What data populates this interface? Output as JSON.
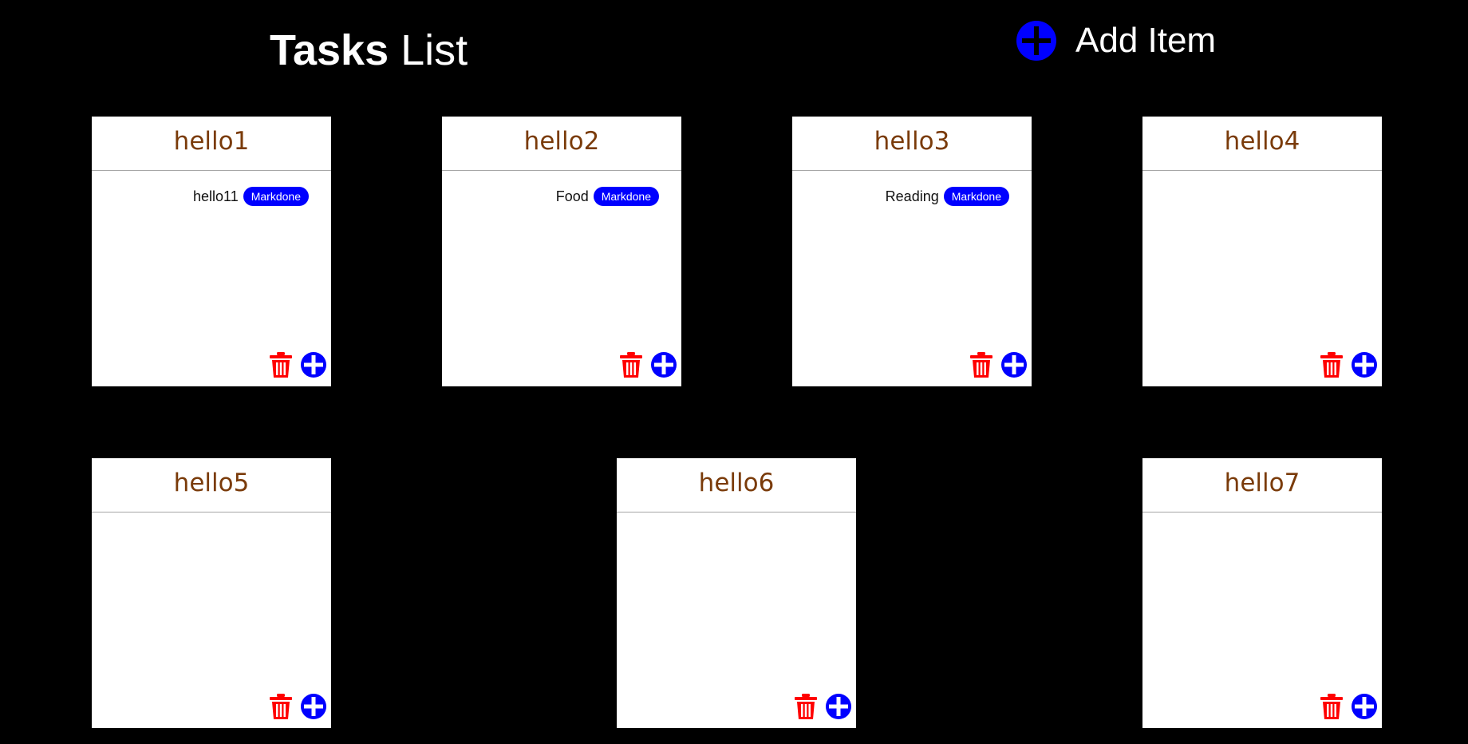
{
  "header": {
    "title_bold": "Tasks",
    "title_rest": "List",
    "add_item_label": "Add Item"
  },
  "colors": {
    "background": "#000000",
    "accent_blue": "#0000ff",
    "delete_red": "#ff0000",
    "card_title": "#7a3b0a"
  },
  "icons": {
    "add": "plus-circle-icon",
    "delete": "trash-icon"
  },
  "cards": [
    {
      "title": "hello1",
      "items": [
        {
          "name": "hello11",
          "action": "Markdone"
        }
      ]
    },
    {
      "title": "hello2",
      "items": [
        {
          "name": "Food",
          "action": "Markdone"
        }
      ]
    },
    {
      "title": "hello3",
      "items": [
        {
          "name": "Reading",
          "action": "Markdone"
        }
      ]
    },
    {
      "title": "hello4",
      "items": []
    },
    {
      "title": "hello5",
      "items": []
    },
    {
      "title": "hello6",
      "items": []
    },
    {
      "title": "hello7",
      "items": []
    }
  ]
}
